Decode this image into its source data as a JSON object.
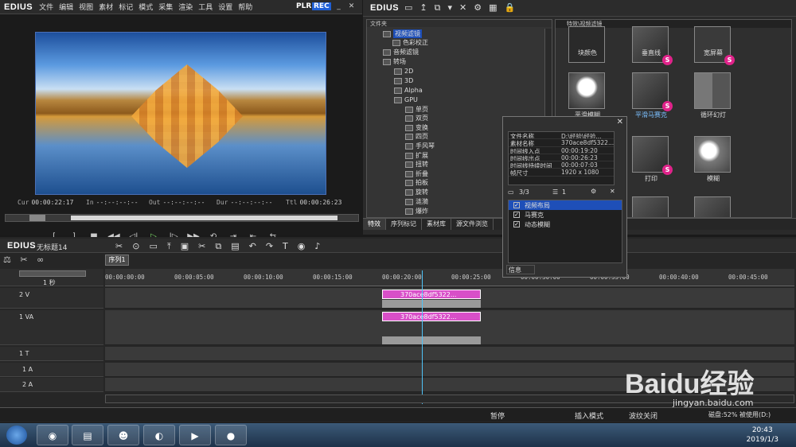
{
  "player": {
    "brand": "EDIUS",
    "menu": [
      "文件",
      "编辑",
      "视图",
      "素材",
      "标记",
      "模式",
      "采集",
      "渲染",
      "工具",
      "设置",
      "帮助"
    ],
    "plr": "PLR",
    "rec": "REC",
    "tc_cur_label": "Cur",
    "tc_cur": "00:00:22:17",
    "tc_in_label": "In",
    "tc_in": "--:--:--:--",
    "tc_out_label": "Out",
    "tc_out": "--:--:--:--",
    "tc_dur_label": "Dur",
    "tc_dur": "--:--:--:--",
    "tc_ttl_label": "Ttl",
    "tc_ttl": "00:00:26:23"
  },
  "bin": {
    "brand": "EDIUS",
    "tree_header": "文件夹",
    "tree": [
      {
        "label": "视频滤镜",
        "selected": true
      },
      {
        "label": "色彩校正"
      },
      {
        "label": "音频滤镜"
      },
      {
        "label": "转场"
      },
      {
        "label": "2D"
      },
      {
        "label": "3D"
      },
      {
        "label": "Alpha"
      },
      {
        "label": "GPU"
      },
      {
        "label": "单页"
      },
      {
        "label": "双页"
      },
      {
        "label": "变换"
      },
      {
        "label": "四页"
      },
      {
        "label": "手风琴"
      },
      {
        "label": "扩展"
      },
      {
        "label": "扭转"
      },
      {
        "label": "折叠"
      },
      {
        "label": "拍板"
      },
      {
        "label": "旋转"
      },
      {
        "label": "涟漪"
      },
      {
        "label": "爆炸"
      }
    ],
    "thumbs_header": "特效\\视频滤镜",
    "thumbs": [
      {
        "label": "块颜色"
      },
      {
        "label": "垂直线"
      },
      {
        "label": "宽屏幕"
      },
      {
        "label": "平滑模糊"
      },
      {
        "label": "平滑马赛克",
        "selected": true
      },
      {
        "label": "循环幻灯"
      },
      {
        "label": ""
      },
      {
        "label": "打印"
      },
      {
        "label": "模糊"
      }
    ],
    "tabs": [
      "特效",
      "序列标记",
      "素材库",
      "源文件浏览"
    ]
  },
  "info": {
    "rows": [
      {
        "k": "文件名称",
        "v": "D:\\经验\\经验..."
      },
      {
        "k": "素材名称",
        "v": "370ace8df5322..."
      },
      {
        "k": "时间线入点",
        "v": "00:00:19:20"
      },
      {
        "k": "时间线出点",
        "v": "00:00:26:23"
      },
      {
        "k": "时间线持续时间",
        "v": "00:00:07:03"
      },
      {
        "k": "帧尺寸",
        "v": "1920 x 1080"
      }
    ],
    "count": "3/3",
    "num": "1",
    "layers": [
      {
        "label": "视频布局",
        "checked": true,
        "selected": true
      },
      {
        "label": "马赛克",
        "checked": true
      },
      {
        "label": "动态模糊",
        "checked": true
      }
    ],
    "footer": "信息"
  },
  "timeline": {
    "brand": "EDIUS",
    "project": "无标题14",
    "sequence_tab": "序列1",
    "scale": "1 秒",
    "ruler": [
      "00:00:00:00",
      "00:00:05:00",
      "00:00:10:00",
      "00:00:15:00",
      "00:00:20:00",
      "00:00:25:00",
      "00:00:30:00",
      "00:00:35:00",
      "00:00:40:00",
      "00:00:45:00"
    ],
    "tracks": [
      {
        "name": "2 V"
      },
      {
        "name": "1 VA"
      },
      {
        "name": "1 T"
      },
      {
        "name": "1 A"
      },
      {
        "name": "2 A"
      }
    ],
    "clip_label": "370ace8df5322...",
    "clip2_label": "370ace8df5322..."
  },
  "status": {
    "paused": "暂停",
    "insert_mode": "插入模式",
    "ripple": "波纹关闭",
    "disk": "磁盘:52% 被使用(D:)"
  },
  "taskbar": {
    "time": "20:43",
    "date": "2019/1/3"
  },
  "watermark": {
    "brand": "Baidu经验",
    "url": "jingyan.baidu.com"
  }
}
